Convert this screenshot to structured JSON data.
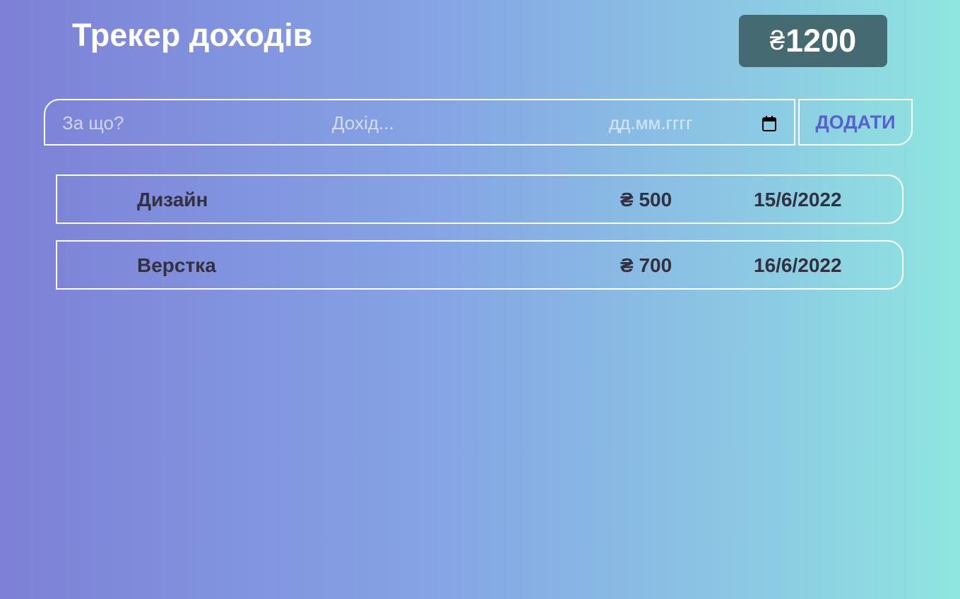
{
  "header": {
    "title": "Трекер доходів",
    "total_currency": "₴",
    "total_value": "1200"
  },
  "form": {
    "what_placeholder": "За що?",
    "amount_placeholder": "Дохід...",
    "date_placeholder": "дд.мм.гггг",
    "add_label": "ДОДАТИ"
  },
  "entries": [
    {
      "name": "Дизайн",
      "amount": "₴ 500",
      "date": "15/6/2022"
    },
    {
      "name": "Верстка",
      "amount": "₴ 700",
      "date": "16/6/2022"
    }
  ],
  "colors": {
    "accent": "#5a5fcf",
    "total_bg": "#466a72",
    "entry_text": "#33303f"
  },
  "icons": {
    "date_picker": "calendar-icon"
  }
}
